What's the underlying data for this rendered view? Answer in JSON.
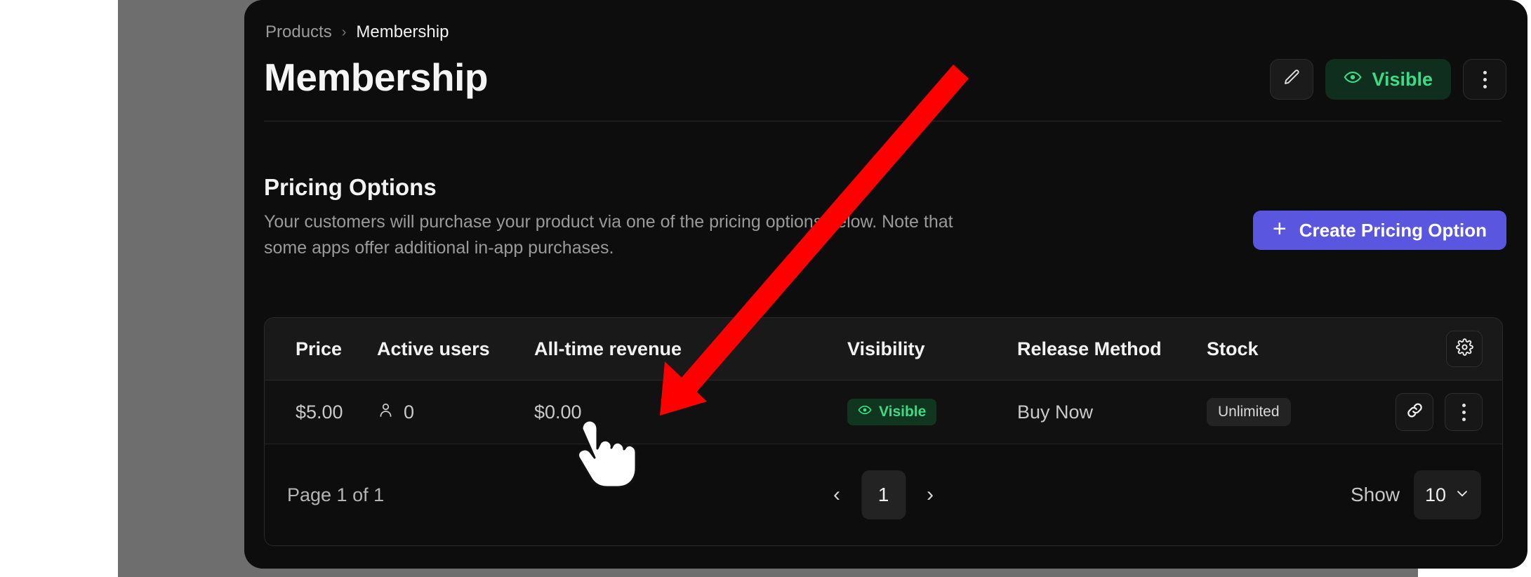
{
  "breadcrumb": {
    "parent": "Products",
    "separator": "›",
    "current": "Membership"
  },
  "header": {
    "title": "Membership",
    "edit_icon": "pencil-icon",
    "visibility_label": "Visible",
    "visibility_icon": "eye-icon",
    "more_icon": "kebab-menu-icon"
  },
  "section": {
    "title": "Pricing Options",
    "description": "Your customers will purchase your product via one of the pricing options below. Note that some apps offer additional in-app purchases.",
    "create_button": "Create Pricing Option",
    "create_icon": "plus-icon"
  },
  "table": {
    "columns": [
      "Price",
      "Active users",
      "All-time revenue",
      "Visibility",
      "Release Method",
      "Stock"
    ],
    "settings_icon": "gear-icon",
    "rows": [
      {
        "price": "$5.00",
        "active_users": "0",
        "active_users_icon": "person-icon",
        "all_time_revenue": "$0.00",
        "visibility": "Visible",
        "visibility_icon": "eye-icon",
        "release_method": "Buy Now",
        "stock": "Unlimited",
        "link_icon": "link-icon",
        "more_icon": "kebab-menu-icon"
      }
    ]
  },
  "footer": {
    "page_label": "Page 1 of 1",
    "prev_icon": "chevron-left-icon",
    "next_icon": "chevron-right-icon",
    "current_page": "1",
    "show_label": "Show",
    "show_value": "10",
    "show_chevron_icon": "chevron-down-icon"
  },
  "colors": {
    "accent_purple": "#5b56e0",
    "success_green": "#3ddc84",
    "success_green_bg": "#0f2e1e",
    "panel_bg": "#0d0d0d",
    "frame_gray": "#6e6e6e",
    "annotation_red": "#fe0000"
  },
  "annotations": {
    "arrow": "red-pointer-arrow",
    "cursor": "hand-cursor"
  }
}
